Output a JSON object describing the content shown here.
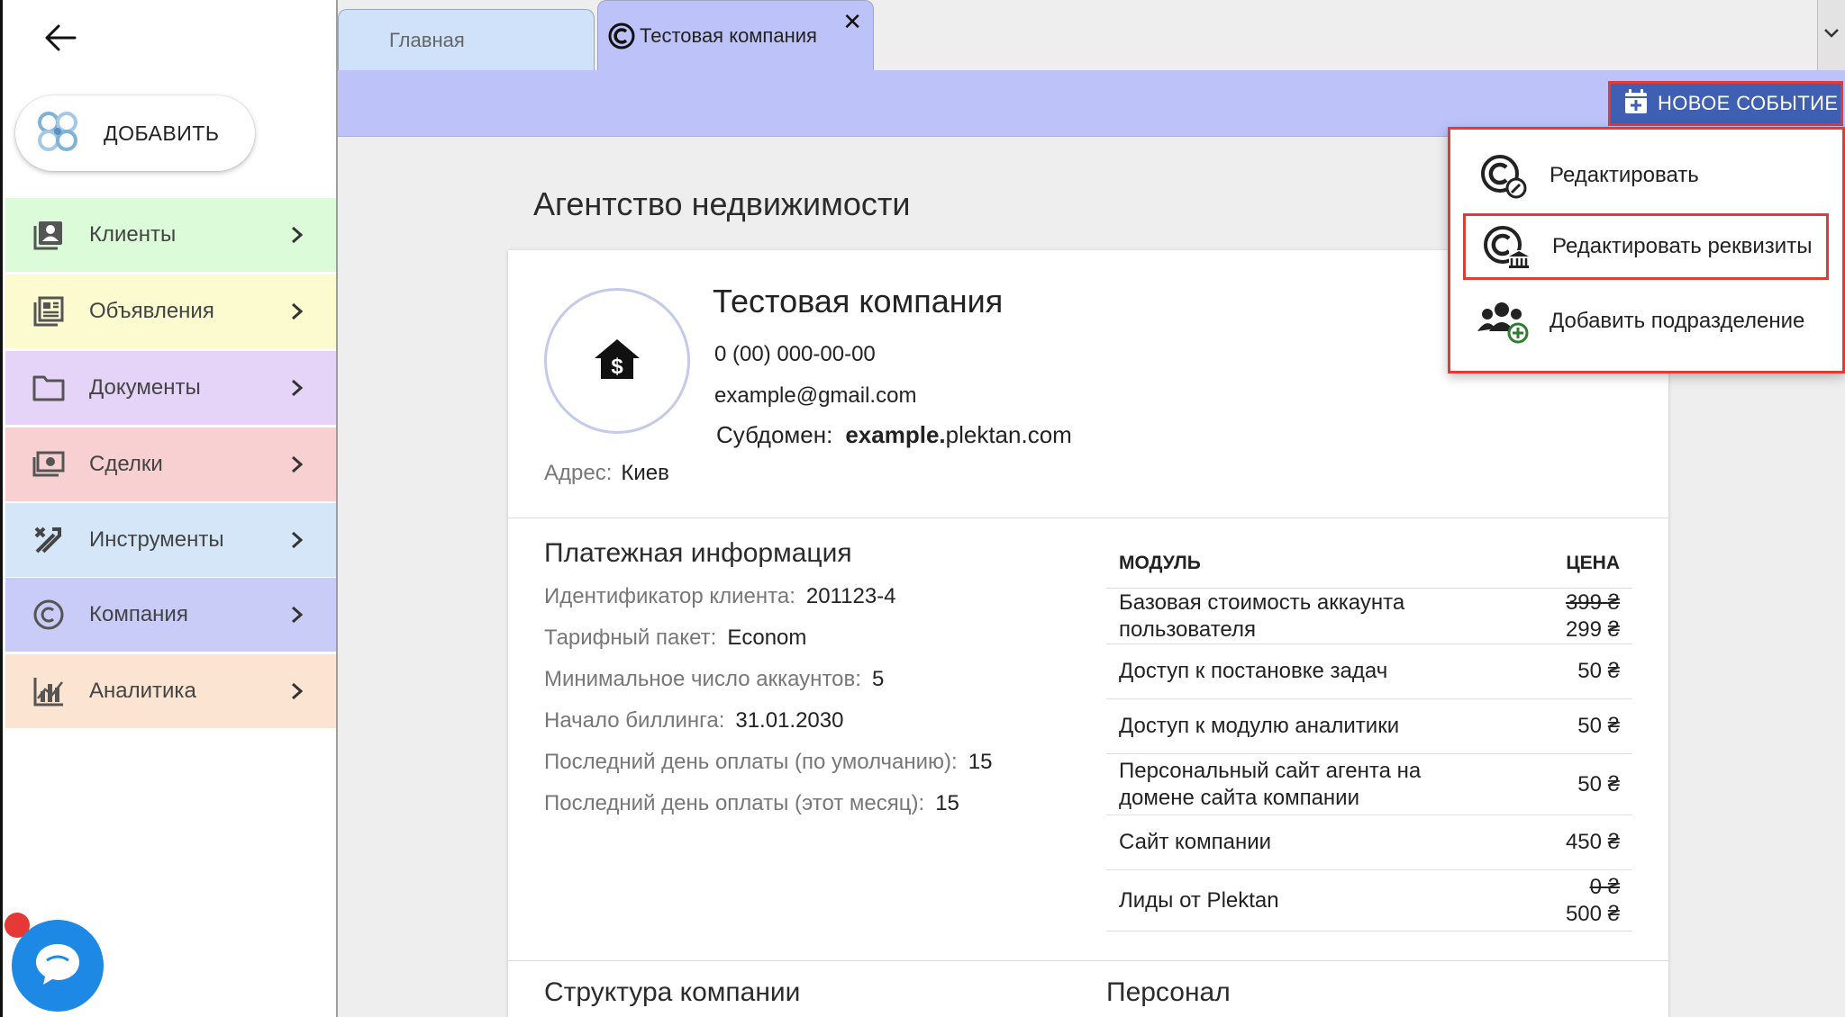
{
  "sidebar": {
    "add_label": "ДОБАВИТЬ",
    "items": [
      {
        "label": "Клиенты",
        "color": "#dcfbd9",
        "icon": "clients-icon"
      },
      {
        "label": "Объявления",
        "color": "#fbfbcf",
        "icon": "listings-icon"
      },
      {
        "label": "Документы",
        "color": "#e6d4f8",
        "icon": "folder-icon"
      },
      {
        "label": "Сделки",
        "color": "#f9d0d2",
        "icon": "deals-icon"
      },
      {
        "label": "Инструменты",
        "color": "#d4e6f8",
        "icon": "tools-icon"
      },
      {
        "label": "Компания",
        "color": "#c9ccf6",
        "icon": "copyright-icon"
      },
      {
        "label": "Аналитика",
        "color": "#fbe4d2",
        "icon": "analytics-icon"
      }
    ]
  },
  "tabs": {
    "home": "Главная",
    "company": "Тестовая компания",
    "close": "✕"
  },
  "toolbar": {
    "new_event": "НОВОЕ СОБЫТИЕ"
  },
  "page": {
    "title": "Агентство недвижимости"
  },
  "company": {
    "name": "Тестовая компания",
    "phone": "0 (00) 000-00-00",
    "email": "example@gmail.com",
    "subdomain_label": "Субдомен:",
    "subdomain_bold": "example.",
    "subdomain_rest": "plektan.com",
    "address_label": "Адрес:",
    "address_value": "Киев"
  },
  "payment": {
    "title": "Платежная информация",
    "rows": [
      {
        "label": "Идентификатор клиента:",
        "value": "201123-4"
      },
      {
        "label": "Тарифный пакет:",
        "value": "Econom"
      },
      {
        "label": "Минимальное число аккаунтов:",
        "value": "5"
      },
      {
        "label": "Начало биллинга:",
        "value": "31.01.2030"
      },
      {
        "label": "Последний день оплаты (по умолчанию):",
        "value": "15"
      },
      {
        "label": "Последний день оплаты (этот месяц):",
        "value": "15"
      }
    ]
  },
  "modules": {
    "col_module": "МОДУЛЬ",
    "col_price": "ЦЕНА",
    "rows": [
      {
        "name_1": "Базовая стоимость аккаунта",
        "name_2": "пользователя",
        "old_price": "399 ₴",
        "price": "299 ₴"
      },
      {
        "name_1": "Доступ к постановке задач",
        "price": "50 ₴"
      },
      {
        "name_1": "Доступ к модулю аналитики",
        "price": "50 ₴"
      },
      {
        "name_1": "Персональный сайт агента на",
        "name_2": "домене сайта компании",
        "price": "50 ₴"
      },
      {
        "name_1": "Сайт компании",
        "price": "450 ₴"
      },
      {
        "name_1": "Лиды от Plektan",
        "old_price": "0 ₴",
        "price": "500 ₴"
      }
    ]
  },
  "sections": {
    "structure": "Структура компании",
    "staff": "Персонал"
  },
  "menu": {
    "edit": "Редактировать",
    "edit_requisites": "Редактировать реквизиты",
    "add_division": "Добавить подразделение"
  },
  "colors": {
    "accent": "#3f5fb2",
    "tab_active": "#bdc3f9",
    "highlight": "#e53935"
  }
}
